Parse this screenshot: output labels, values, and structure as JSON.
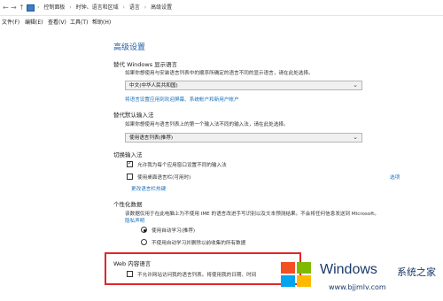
{
  "breadcrumb": {
    "items": [
      "控制面板",
      "时钟、语言和区域",
      "语言",
      "高级设置"
    ],
    "separator": "›"
  },
  "nav": {
    "back": "←",
    "forward": "→",
    "up": "↑",
    "dropdown": "⌄"
  },
  "menu": [
    "文件(F)",
    "编辑(E)",
    "查看(V)",
    "工具(T)",
    "帮助(H)"
  ],
  "page_title": "高级设置",
  "display_language": {
    "title": "替代 Windows 显示语言",
    "desc": "如果你想使用与安装语言列表中的顺序所确定的语言不同的显示语言，请在此处选择。",
    "value": "中文(中华人民共和国)",
    "link": "将语言设置应用到欢迎屏幕、系统帐户和新用户帐户"
  },
  "default_input": {
    "title": "替代默认输入法",
    "desc": "如果你想使用与语言列表上的第一个输入法不同的输入法，请在此处选择。",
    "value": "使用语言列表(推荐)"
  },
  "switch_input": {
    "title": "切换输入法",
    "opt1": "允许我为每个应用窗口设置不同的输入法",
    "opt1_checked": true,
    "opt2": "使用桌面语言栏(可用时)",
    "opt2_checked": false,
    "opt2_link": "选项",
    "link": "更改语言栏热键"
  },
  "personalization": {
    "title": "个性化数据",
    "desc": "该数据仅用于在此电脑上为不使用 IME 的语言改进手写识别以及文本预测结果。不会将任何信息发送到 Microsoft。",
    "privacy": "隐私声明",
    "radio1": "使用自动学习(推荐)",
    "radio2": "不使用自动学习并删除以前收集的所有数据",
    "selected": 1
  },
  "web_language": {
    "title": "Web 内容语言",
    "opt": "不允许网站访问我的语言列表。将使用我的日期、时间",
    "checked": false
  },
  "watermark": {
    "windows": "Windows",
    "site_name": "系统之家",
    "url": "www.bjjmlv.com",
    "logo_colors": [
      "#f25022",
      "#7fba00",
      "#00a4ef",
      "#ffb900"
    ]
  }
}
